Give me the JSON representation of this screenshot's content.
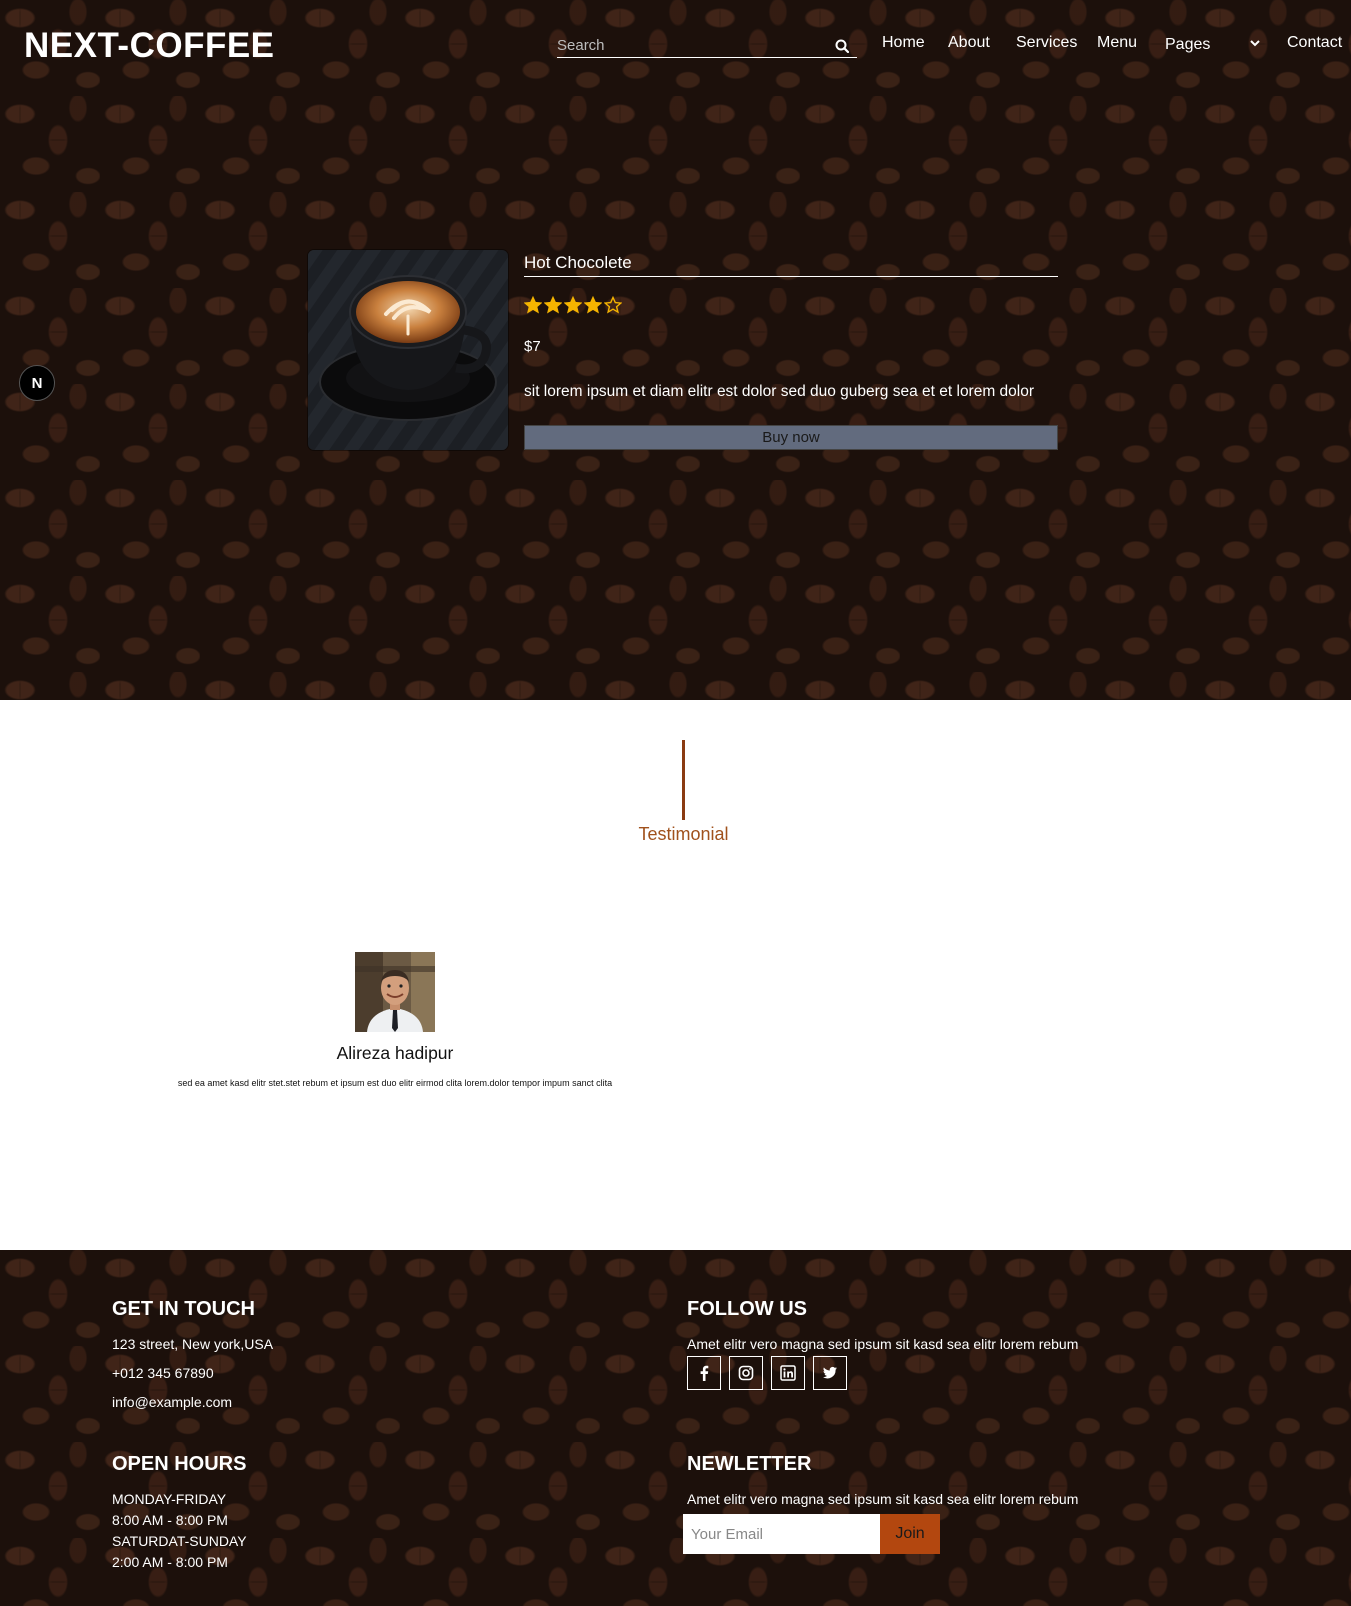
{
  "brand": {
    "logo": "NEXT-COFFEE"
  },
  "search": {
    "placeholder": "Search"
  },
  "nav": {
    "items": [
      "Home",
      "About",
      "Services",
      "Menu",
      "Pages",
      "Contact"
    ]
  },
  "side_badge": {
    "letter": "N"
  },
  "product": {
    "title": "Hot Chocolete",
    "rating": 4,
    "rating_max": 5,
    "price": "$7",
    "description": "sit lorem ipsum et diam elitr est dolor sed duo guberg sea et et lorem dolor",
    "buy_label": "Buy now"
  },
  "testimonial": {
    "section_label": "Testimonial",
    "name": "Alireza hadipur",
    "quote": "sed ea amet kasd elitr stet.stet rebum et ipsum est duo elitr eirmod clita lorem.dolor tempor impum sanct clita"
  },
  "footer": {
    "touch": {
      "heading": "GET IN TOUCH",
      "address": "123 street, New york,USA",
      "phone": "+012 345 67890",
      "email": "info@example.com"
    },
    "follow": {
      "heading": "FOLLOW US",
      "text": "Amet elitr vero magna sed ipsum sit kasd sea elitr lorem rebum",
      "icons": [
        "facebook-icon",
        "instagram-icon",
        "linkedin-icon",
        "twitter-icon"
      ]
    },
    "hours": {
      "heading": "OPEN HOURS",
      "lines": [
        "MONDAY-FRIDAY",
        "8:00 AM - 8:00 PM",
        "SATURDAT-SUNDAY",
        "2:00 AM - 8:00 PM"
      ]
    },
    "newsletter": {
      "heading": "NEWLETTER",
      "text": "Amet elitr vero magna sed ipsum sit kasd sea elitr lorem rebum",
      "email_placeholder": "Your Email",
      "join_label": "Join"
    }
  },
  "colors": {
    "accent": "#b3470f",
    "testimonial_label": "#a0511c",
    "star": "#f5b400",
    "buy_button": "#626b7e"
  }
}
